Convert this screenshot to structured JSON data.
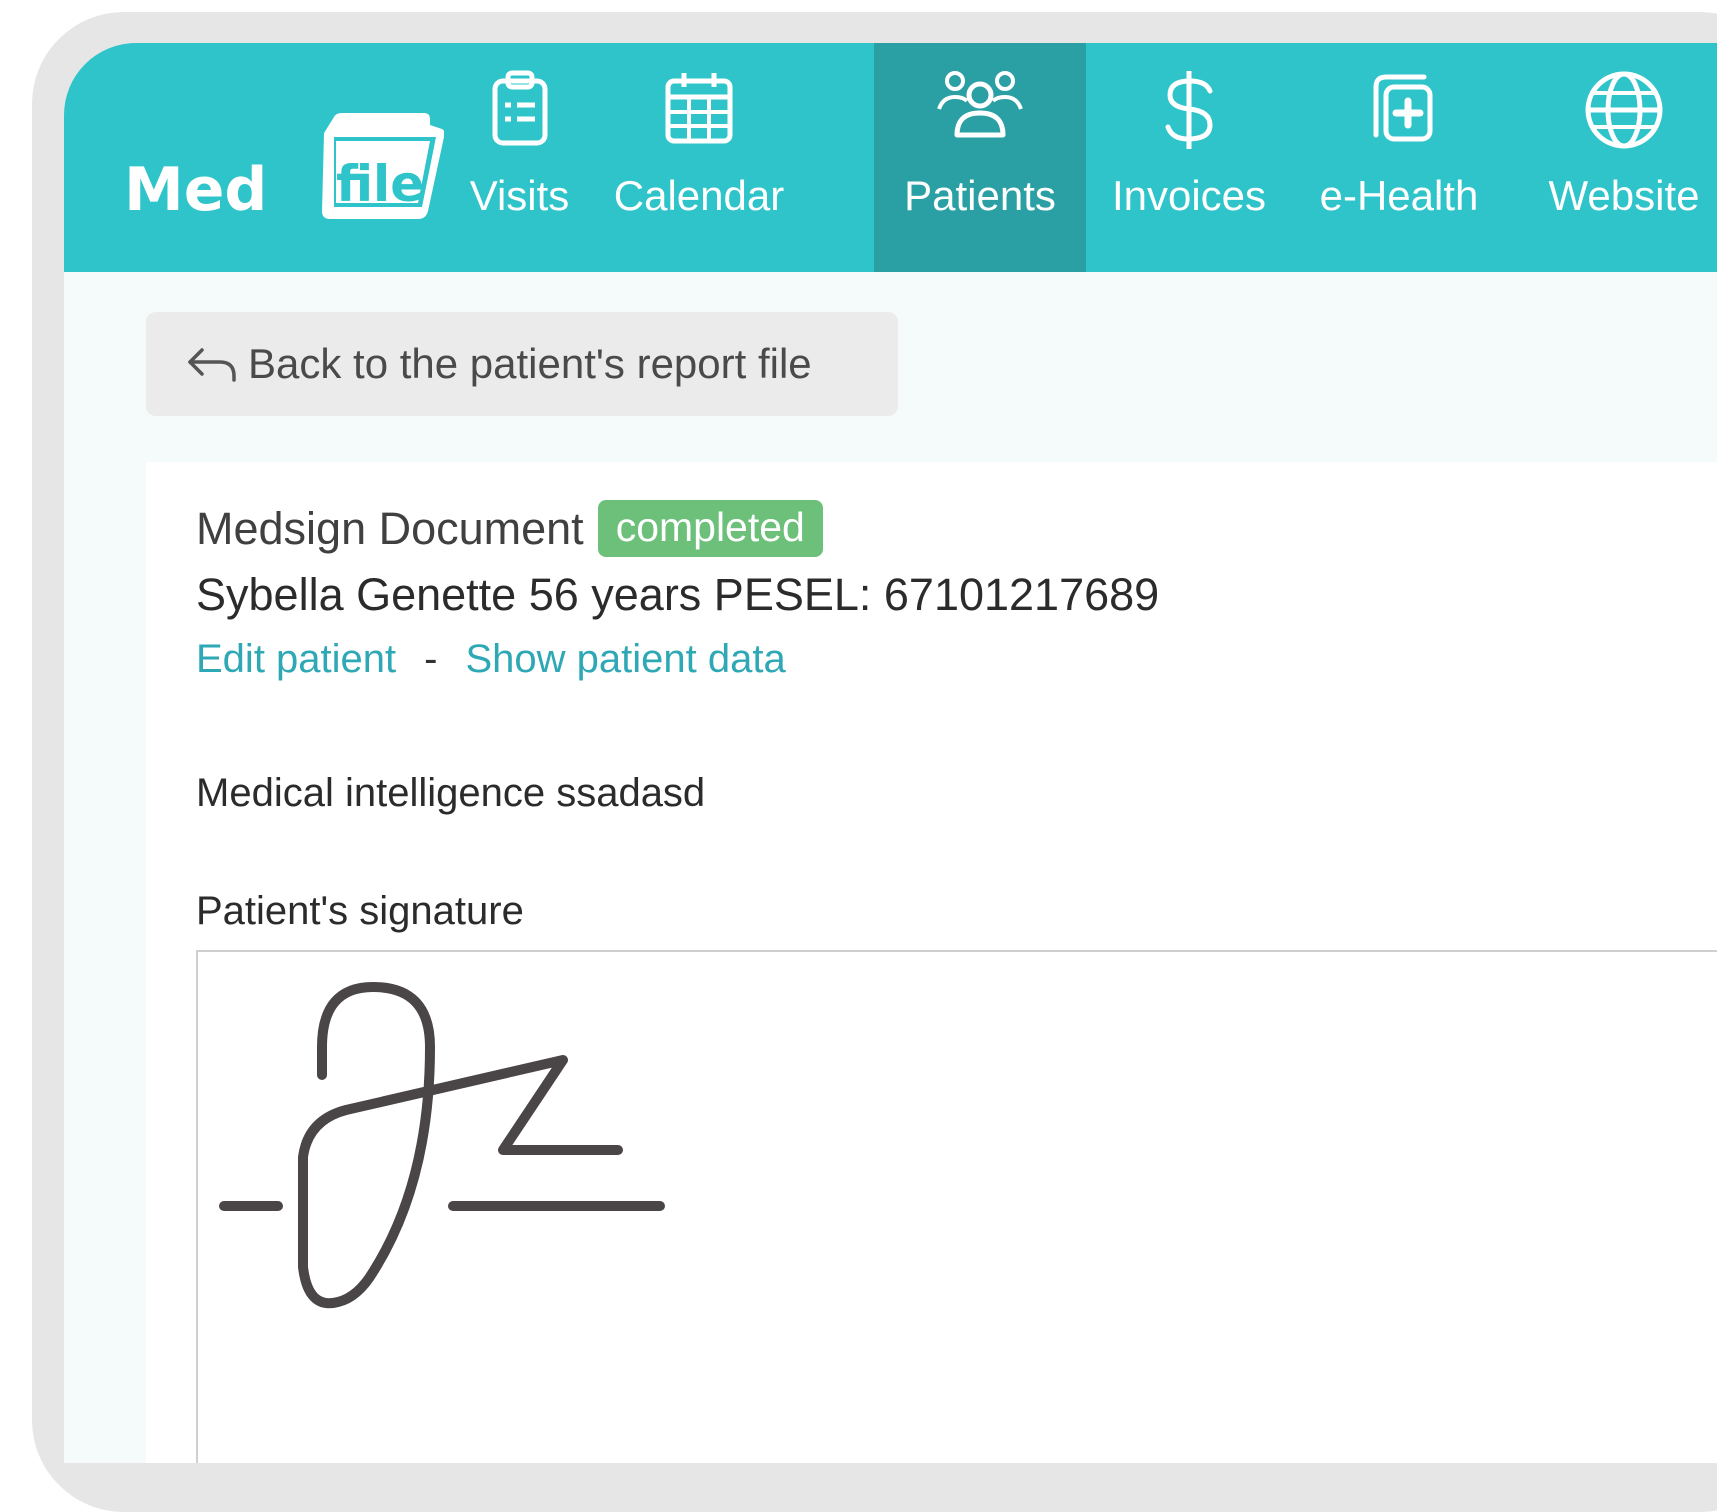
{
  "app": {
    "logo": "Med file",
    "nav": [
      {
        "label": "Visits",
        "icon": "clipboard-list-icon"
      },
      {
        "label": "Calendar",
        "icon": "calendar-icon"
      },
      {
        "label": "Patients",
        "icon": "users-icon",
        "active": true
      },
      {
        "label": "Invoices",
        "icon": "dollar-icon"
      },
      {
        "label": "e-Health",
        "icon": "medical-copy-icon"
      },
      {
        "label": "Website",
        "icon": "globe-icon"
      }
    ]
  },
  "back_button": {
    "label": "Back to the patient's report file",
    "icon": "back-arrow-icon"
  },
  "document": {
    "title": "Medsign Document",
    "status": "completed",
    "patient_line": "Sybella Genette 56 years PESEL: 67101217689",
    "links": {
      "edit": "Edit patient",
      "separator": "-",
      "show": "Show patient data"
    },
    "medical_text": "Medical intelligence ssadasd",
    "signature_label": "Patient's signature"
  },
  "colors": {
    "topbar": "#2ec4c9",
    "active_nav": "#2a9fa4",
    "link": "#2ea8b5",
    "badge": "#6cc079"
  }
}
